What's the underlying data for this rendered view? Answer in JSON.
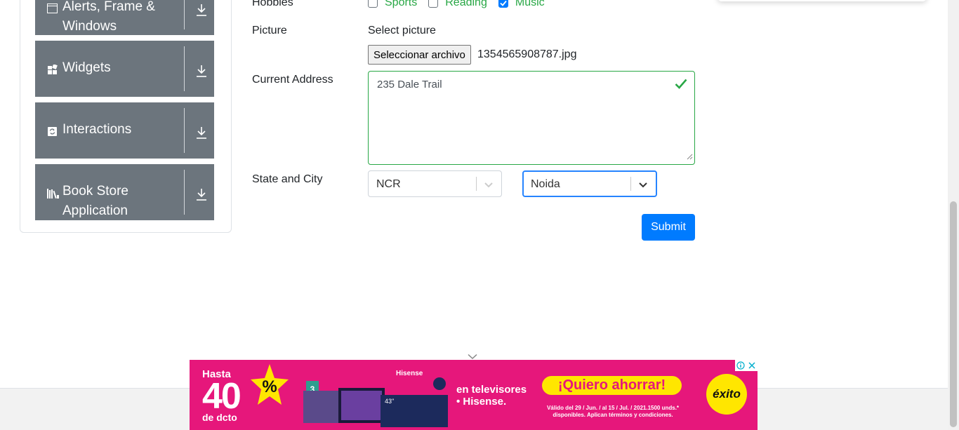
{
  "sidebar": {
    "groups": [
      {
        "title": "Alerts, Frame & Windows",
        "icon": "window-icon"
      },
      {
        "title": "Widgets",
        "icon": "widgets-icon"
      },
      {
        "title": "Interactions",
        "icon": "interactions-icon"
      },
      {
        "title": "Book Store Application",
        "icon": "books-icon"
      }
    ]
  },
  "form": {
    "hobbies_label": "Hobbies",
    "hobbies": [
      {
        "label": "Sports",
        "checked": false
      },
      {
        "label": "Reading",
        "checked": false
      },
      {
        "label": "Music",
        "checked": true
      }
    ],
    "picture_label": "Picture",
    "select_picture": "Select picture",
    "file_button": "Seleccionar archivo",
    "file_name": "1354565908787.jpg",
    "address_label": "Current Address",
    "address_value": "235 Dale Trail",
    "state_city_label": "State and City",
    "state_value": "NCR",
    "city_value": "Noida",
    "submit_label": "Submit"
  },
  "ad": {
    "hasta": "Hasta",
    "discount": "40",
    "percent_sign": "%",
    "dcto": "de dcto",
    "tv_brand": "Hisense",
    "tv_size": "43\"",
    "tagline_1": "en televisores",
    "tagline_2": "• Hisense.",
    "cta": "¡Quiero ahorrar!",
    "legal": "Válido del 29 / Jun. / al 15 / Jul. / 2021.1500 unds.* disponibles. Aplican términos y condiciones.",
    "store_logo": "éxito",
    "badge_years": "3"
  },
  "colors": {
    "sidebar_group": "#6c757d",
    "valid_green": "#28a745",
    "primary": "#007bff",
    "ad_pink": "#e6177b",
    "ad_yellow": "#ffe600"
  }
}
